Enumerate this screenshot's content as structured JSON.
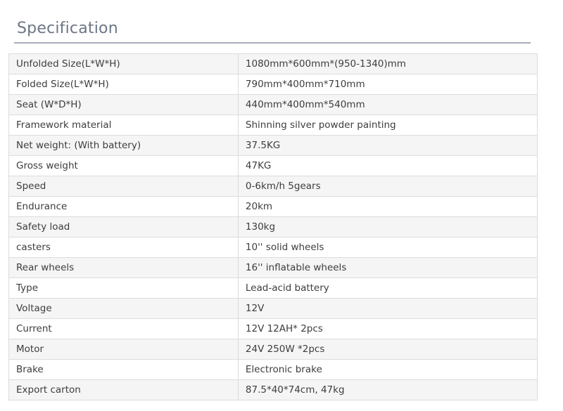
{
  "heading": "Specification",
  "specs": [
    {
      "label": "Unfolded Size(L*W*H)",
      "value": "1080mm*600mm*(950-1340)mm"
    },
    {
      "label": "Folded Size(L*W*H)",
      "value": "790mm*400mm*710mm"
    },
    {
      "label": "Seat (W*D*H)",
      "value": "440mm*400mm*540mm"
    },
    {
      "label": "Framework material",
      "value": "Shinning silver powder painting"
    },
    {
      "label": "Net weight: (With battery)",
      "value": "37.5KG"
    },
    {
      "label": "Gross weight",
      "value": "47KG"
    },
    {
      "label": "Speed",
      "value": "0-6km/h 5gears"
    },
    {
      "label": "Endurance",
      "value": "20km"
    },
    {
      "label": "Safety load",
      "value": "130kg"
    },
    {
      "label": "casters",
      "value": "10'' solid wheels"
    },
    {
      "label": "Rear wheels",
      "value": "16'' inflatable wheels"
    },
    {
      "label": "Type",
      "value": "Lead-acid battery"
    },
    {
      "label": "Voltage",
      "value": "12V"
    },
    {
      "label": "Current",
      "value": "12V 12AH* 2pcs"
    },
    {
      "label": "Motor",
      "value": "24V 250W *2pcs"
    },
    {
      "label": "Brake",
      "value": "Electronic brake"
    },
    {
      "label": "Export carton",
      "value": "87.5*40*74cm, 47kg"
    }
  ]
}
